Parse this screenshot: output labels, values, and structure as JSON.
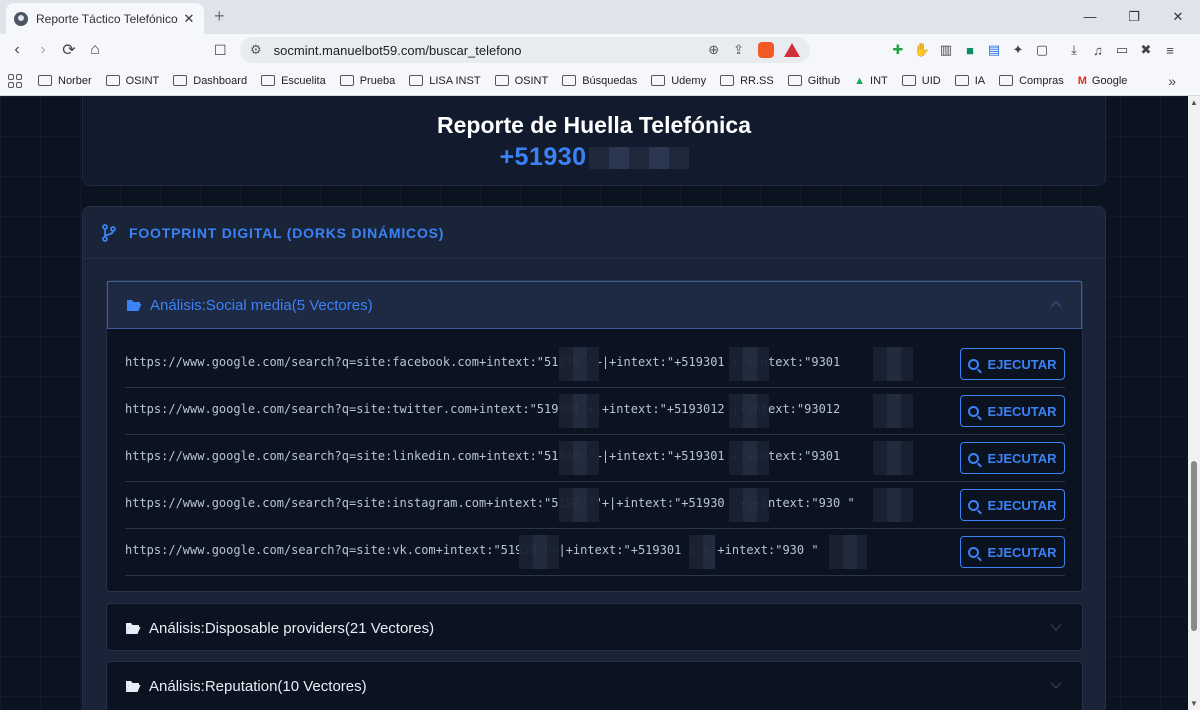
{
  "browser": {
    "tab_title": "Reporte Táctico Telefónico | SOC",
    "tab_close": "✕",
    "new_tab": "+",
    "url": "socmint.manuelbot59.com/buscar_telefono",
    "window_controls": [
      "—",
      "❐",
      "✕"
    ],
    "bookmarks": [
      "Norber",
      "OSINT",
      "Dashboard",
      "Escuelita",
      "Prueba",
      "LISA INST",
      "OSINT",
      "Búsquedas",
      "Udemy",
      "RR.SS",
      "Github",
      "INT",
      "UID",
      "IA",
      "Compras",
      "Google"
    ],
    "bookmarks_more": "»"
  },
  "report": {
    "title": "Reporte de Huella Telefónica",
    "phone_visible": "+51930"
  },
  "panel": {
    "title": "FOOTPRINT DIGITAL (DORKS DINÁMICOS)"
  },
  "accordions": [
    {
      "label": "Análisis:Social media(5 Vectores)",
      "expanded": true
    },
    {
      "label": "Análisis:Disposable providers(21 Vectores)",
      "expanded": false
    },
    {
      "label": "Análisis:Reputation(10 Vectores)",
      "expanded": false
    }
  ],
  "social_rows": [
    {
      "query": "https://www.google.com/search?q=site:facebook.com+intext:\"51930       \"+|+intext:\"+519301      +|+intext:\"9301"
    },
    {
      "query": "https://www.google.com/search?q=site:twitter.com+intext:\"519301      +|+intext:\"+5193012      |+intext:\"93012"
    },
    {
      "query": "https://www.google.com/search?q=site:linkedin.com+intext:\"51930       \"+|+intext:\"+519301      +|+intext:\"9301"
    },
    {
      "query": "https://www.google.com/search?q=site:instagram.com+intext:\"5193      3\"+|+intext:\"+51930       \"+|+intext:\"930      \""
    },
    {
      "query": "https://www.google.com/search?q=site:vk.com+intext:\"51930      \"+|+intext:\"+519301     3\"+|+intext:\"930      \""
    }
  ],
  "execute_label": "EJECUTAR",
  "colors": {
    "accent": "#3b82f6",
    "bg": "#0b1220",
    "panel": "#1a2438"
  }
}
